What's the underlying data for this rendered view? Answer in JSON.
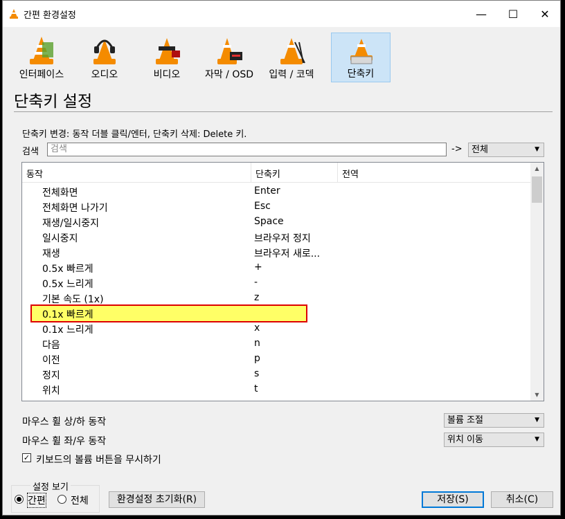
{
  "window": {
    "title": "간편 환경설정",
    "controls": [
      "minimize",
      "maximize",
      "close"
    ]
  },
  "categories": [
    {
      "label": "인터페이스",
      "icon": "interface-icon",
      "selected": false
    },
    {
      "label": "오디오",
      "icon": "audio-icon",
      "selected": false
    },
    {
      "label": "비디오",
      "icon": "video-icon",
      "selected": false
    },
    {
      "label": "자막 / OSD",
      "icon": "subtitles-icon",
      "selected": false
    },
    {
      "label": "입력 / 코덱",
      "icon": "input-codecs-icon",
      "selected": false
    },
    {
      "label": "단축키",
      "icon": "hotkeys-icon",
      "selected": true
    }
  ],
  "heading": "단축키 설정",
  "hint": "단축키 변경: 동작 더블 클릭/엔터, 단축키 삭제: Delete 키.",
  "search": {
    "label": "검색",
    "placeholder": "검색",
    "arrow": "->",
    "scope": "전체"
  },
  "table": {
    "columns": [
      "동작",
      "단축키",
      "전역"
    ],
    "rows": [
      {
        "action": "전체화면",
        "hotkey": "Enter"
      },
      {
        "action": "전체화면 나가기",
        "hotkey": "Esc"
      },
      {
        "action": "재생/일시중지",
        "hotkey": "Space"
      },
      {
        "action": "일시중지",
        "hotkey": "브라우저 정지"
      },
      {
        "action": "재생",
        "hotkey": "브라우저 새로..."
      },
      {
        "action": "0.5x 빠르게",
        "hotkey": "+"
      },
      {
        "action": "0.5x 느리게",
        "hotkey": "-"
      },
      {
        "action": "기본 속도 (1x)",
        "hotkey": "z"
      },
      {
        "action": "0.1x 빠르게",
        "hotkey": ""
      },
      {
        "action": "0.1x 느리게",
        "hotkey": "x"
      },
      {
        "action": "다음",
        "hotkey": "n"
      },
      {
        "action": "이전",
        "hotkey": "p"
      },
      {
        "action": "정지",
        "hotkey": "s"
      },
      {
        "action": "위치",
        "hotkey": "t"
      }
    ],
    "selected_index": 8
  },
  "mouse": {
    "wheel_updown_label": "마우스 휠 상/하 동작",
    "wheel_updown_value": "볼륨 조절",
    "wheel_leftright_label": "마우스 휠 좌/우 동작",
    "wheel_leftright_value": "위치 이동"
  },
  "ignore_volume_keys": {
    "label": "키보드의 볼륨 버튼을 무시하기",
    "checked": true
  },
  "show_settings": {
    "title": "설정 보기",
    "simple": "간편",
    "all": "전체",
    "selected": "simple"
  },
  "buttons": {
    "reset": "환경설정 초기화(R)",
    "save": "저장(S)",
    "cancel": "취소(C)"
  }
}
